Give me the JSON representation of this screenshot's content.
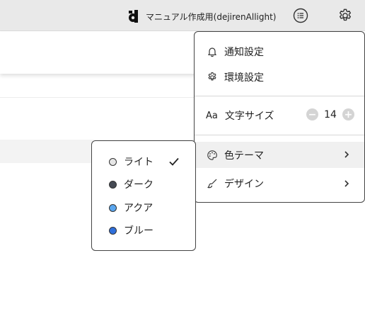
{
  "header": {
    "workspace_name": "マニュアル作成用(dejirenAllight)",
    "icons": [
      "dejiren-logo-icon",
      "list-icon",
      "gear-icon"
    ]
  },
  "settings_menu": {
    "notifications_label": "通知設定",
    "environment_label": "環境設定",
    "font_size_icon_text": "Aa",
    "font_size_label": "文字サイズ",
    "font_size_value": "14",
    "color_theme_label": "色テーマ",
    "design_label": "デザイン"
  },
  "theme_menu": {
    "items": [
      {
        "label": "ライト",
        "color": "#e6e6e6",
        "selected": true
      },
      {
        "label": "ダーク",
        "color": "#454a54",
        "selected": false
      },
      {
        "label": "アクア",
        "color": "#5aa6ee",
        "selected": false
      },
      {
        "label": "ブルー",
        "color": "#2f6fdb",
        "selected": false
      }
    ]
  },
  "colors": {
    "topbar_bg": "#e9e9e9",
    "menu_border": "#444444",
    "highlight_bg": "#f0f0f0"
  }
}
